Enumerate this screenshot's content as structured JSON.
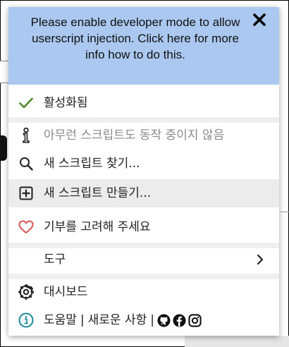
{
  "notice": {
    "text": "Please enable developer mode to allow userscript injection. Click here for more info how to do this.",
    "close_label": "✕"
  },
  "menu": {
    "enabled_label": "활성화됨",
    "no_scripts_label": "아무런 스크립트도 동작 중이지 않음",
    "find_label": "새 스크립트 찾기...",
    "create_label": "새 스크립트 만들기...",
    "donate_label": "기부를 고려해 주세요",
    "tools_label": "도구",
    "dashboard_label": "대시보드",
    "help_label": "도움말",
    "changelog_label": "새로운 사항",
    "separator": "|"
  },
  "colors": {
    "notice_bg": "#abc8f0",
    "check_green": "#4a8a2a",
    "heart_red": "#d9534f",
    "info_teal": "#1a8a9a"
  },
  "icons": {
    "enabled": "check-icon",
    "no_scripts": "info-i-icon",
    "find": "search-icon",
    "create": "plus-square-icon",
    "donate": "heart-icon",
    "tools": "chevron-right-icon",
    "dashboard": "gear-icon",
    "help": "info-circle-icon",
    "social": [
      "github-icon",
      "facebook-icon",
      "instagram-icon"
    ]
  }
}
